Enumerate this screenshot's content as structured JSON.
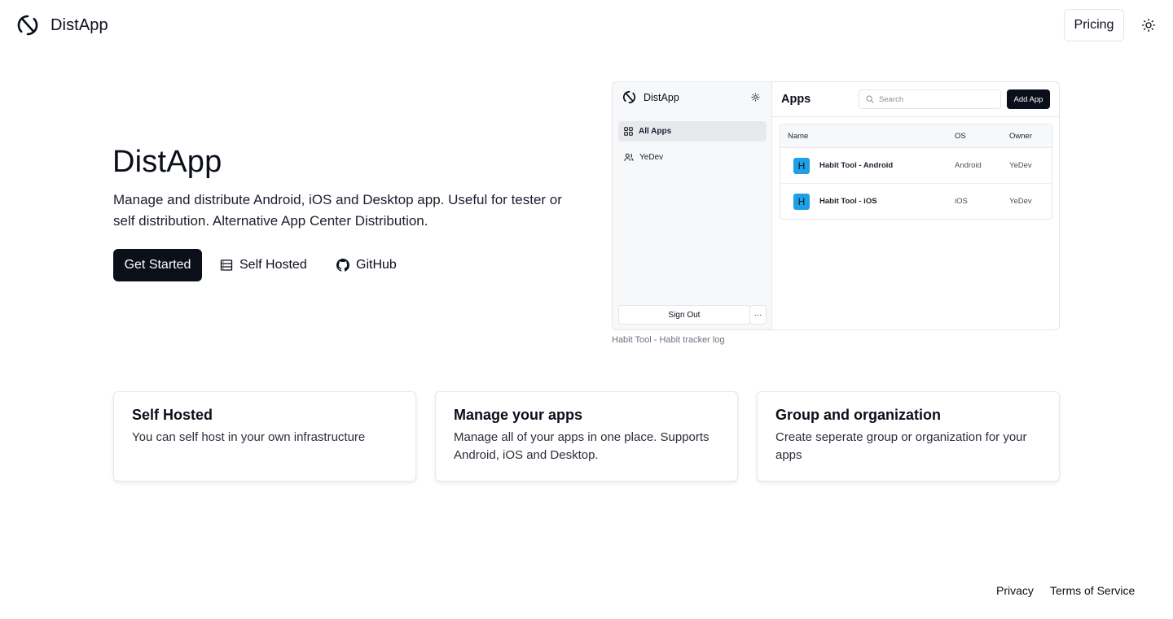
{
  "header": {
    "brand_name": "DistApp",
    "pricing_label": "Pricing"
  },
  "hero": {
    "title": "DistApp",
    "description": "Manage and distribute Android, iOS and Desktop app. Useful for tester or self distribution. Alternative App Center Distribution.",
    "get_started_label": "Get Started",
    "self_hosted_label": "Self Hosted",
    "github_label": "GitHub"
  },
  "preview": {
    "brand_name": "DistApp",
    "nav": [
      {
        "label": "All Apps",
        "icon": "grid-icon",
        "active": true
      },
      {
        "label": "YeDev",
        "icon": "users-icon",
        "active": false
      }
    ],
    "sign_out_label": "Sign Out",
    "more_label": "···",
    "title": "Apps",
    "search_placeholder": "Search",
    "add_app_label": "Add App",
    "columns": [
      "Name",
      "OS",
      "Owner"
    ],
    "rows": [
      {
        "avatar": "H",
        "name": "Habit Tool - Android",
        "os": "Android",
        "owner": "YeDev"
      },
      {
        "avatar": "H",
        "name": "Habit Tool - iOS",
        "os": "iOS",
        "owner": "YeDev"
      }
    ],
    "caption": "Habit Tool - Habit tracker log"
  },
  "features": [
    {
      "title": "Self Hosted",
      "description": "You can self host in your own infrastructure"
    },
    {
      "title": "Manage your apps",
      "description": "Manage all of your apps in one place. Supports Android, iOS and Desktop."
    },
    {
      "title": "Group and organization",
      "description": "Create seperate group or organization for your apps"
    }
  ],
  "footer": {
    "privacy_label": "Privacy",
    "terms_label": "Terms of Service"
  },
  "colors": {
    "primary": "#0b0f1a",
    "avatar": "#1ea0e6",
    "border": "#e3e5ea"
  }
}
